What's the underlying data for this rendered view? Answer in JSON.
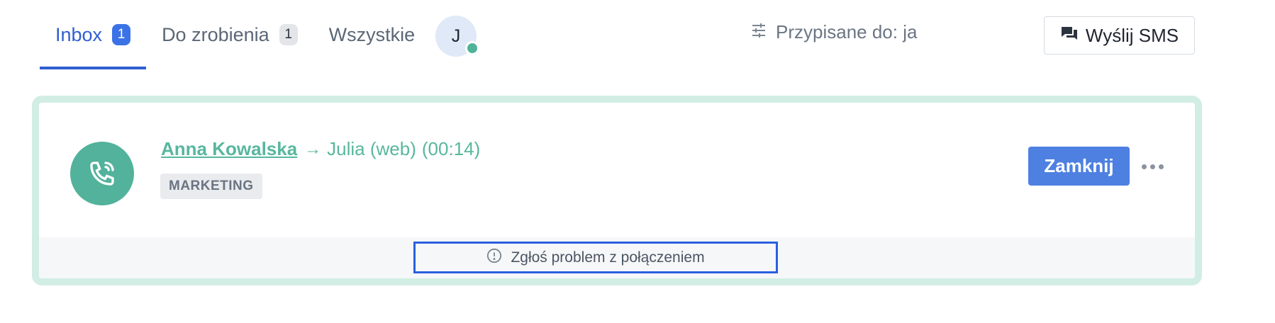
{
  "tabs": [
    {
      "label": "Inbox",
      "count": "1"
    },
    {
      "label": "Do zrobienia",
      "count": "1"
    },
    {
      "label": "Wszystkie"
    }
  ],
  "user": {
    "initial": "J",
    "status_color": "#4fb39a"
  },
  "filter": {
    "icon": "sliders-icon",
    "label": "Przypisane do: ja"
  },
  "sms_button": {
    "icon": "chat-icon",
    "label": "Wyślij SMS"
  },
  "conversation": {
    "icon": "phone-call-icon",
    "caller": "Anna Kowalska",
    "arrow": "→",
    "agent": "Julia (web)",
    "duration": "(00:14)",
    "tag": "MARKETING",
    "close_label": "Zamknij",
    "report": {
      "icon": "alert-circle-icon",
      "label": "Zgłoś problem z połączeniem"
    }
  },
  "colors": {
    "accent": "#2f5fd0",
    "primary_button": "#4d80e1",
    "call_green": "#52b29b",
    "card_border": "#d2ede4",
    "focus_outline": "#2a5fe0"
  }
}
